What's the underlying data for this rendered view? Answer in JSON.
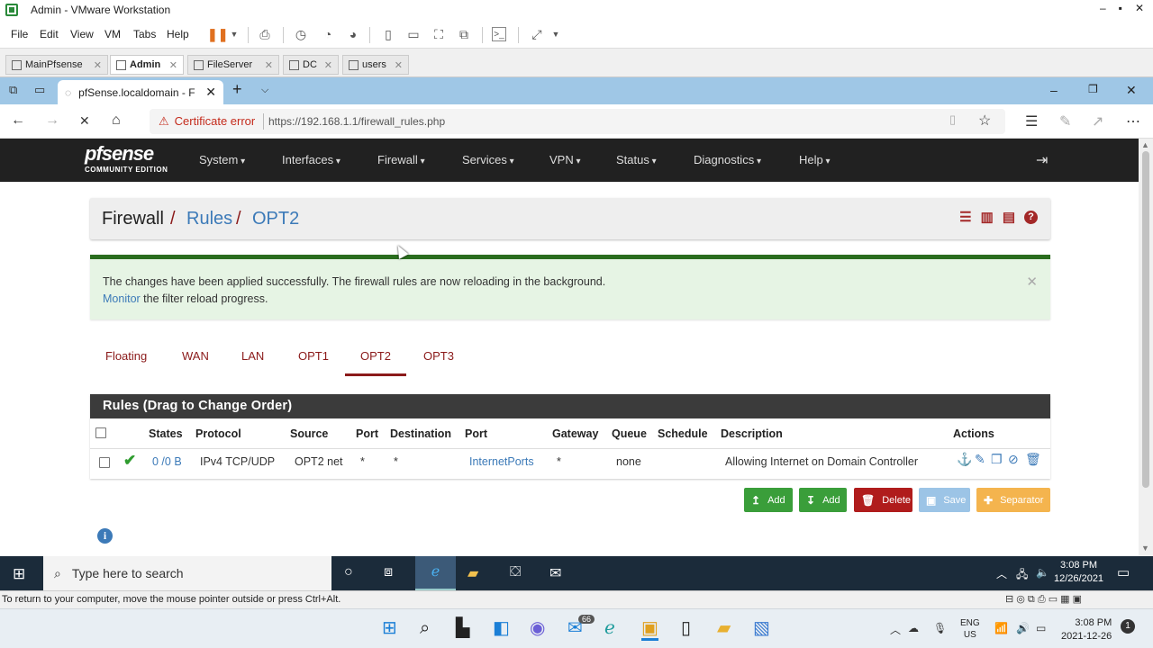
{
  "vmware": {
    "window_title": "Admin - VMware Workstation",
    "window_controls": [
      "–",
      "▪",
      "✕"
    ],
    "menu": [
      "File",
      "Edit",
      "View",
      "VM",
      "Tabs",
      "Help"
    ],
    "tabs": [
      {
        "label": "MainPfsense",
        "active": false
      },
      {
        "label": "Admin",
        "active": true
      },
      {
        "label": "FileServer",
        "active": false
      },
      {
        "label": "DC",
        "active": false
      },
      {
        "label": "users",
        "active": false
      }
    ],
    "status_message": "To return to your computer, move the mouse pointer outside or press Ctrl+Alt."
  },
  "browser": {
    "tab_title": "pfSense.localdomain - F",
    "new_tab": "+",
    "cert_warning": "Certificate error",
    "url": "https://192.168.1.1/firewall_rules.php"
  },
  "pfsense": {
    "logo_main": "pfsense",
    "logo_sub": "COMMUNITY EDITION",
    "nav": [
      "System",
      "Interfaces",
      "Firewall",
      "Services",
      "VPN",
      "Status",
      "Diagnostics",
      "Help"
    ],
    "breadcrumb": {
      "root": "Firewall",
      "sep": "/",
      "level1": "Rules",
      "level2": "OPT2"
    },
    "alert": {
      "line1": "The changes have been applied successfully. The firewall rules are now reloading in the background.",
      "link": "Monitor",
      "line2_rest": " the filter reload progress."
    },
    "interface_tabs": [
      "Floating",
      "WAN",
      "LAN",
      "OPT1",
      "OPT2",
      "OPT3"
    ],
    "active_tab": "OPT2",
    "panel_title": "Rules (Drag to Change Order)",
    "columns": [
      "States",
      "Protocol",
      "Source",
      "Port",
      "Destination",
      "Port",
      "Gateway",
      "Queue",
      "Schedule",
      "Description",
      "Actions"
    ],
    "rules": [
      {
        "states": "0 /0 B",
        "protocol": "IPv4 TCP/UDP",
        "source": "OPT2 net",
        "source_port": "*",
        "destination": "*",
        "dest_port": "InternetPorts",
        "gateway": "*",
        "queue": "none",
        "schedule": "",
        "description": "Allowing Internet on Domain Controller"
      }
    ],
    "buttons": {
      "add_top": "Add",
      "add_bottom": "Add",
      "delete": "Delete",
      "save": "Save",
      "separator": "Separator"
    }
  },
  "guest_taskbar": {
    "search_placeholder": "Type here to search",
    "time": "3:08 PM",
    "date": "12/26/2021"
  },
  "host_taskbar": {
    "badge": "66",
    "lang_top": "ENG",
    "lang_bottom": "US",
    "time": "3:08 PM",
    "date": "2021-12-26",
    "notification_count": "1"
  }
}
